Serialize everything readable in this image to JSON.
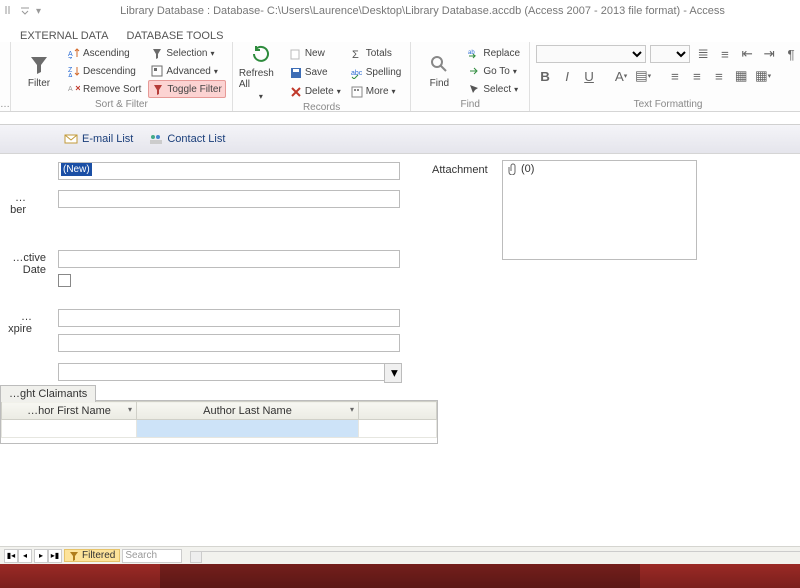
{
  "title": "Library Database : Database- C:\\Users\\Laurence\\Desktop\\Library Database.accdb (Access 2007 - 2013 file format) - Access",
  "tabs": {
    "external_data": "EXTERNAL DATA",
    "db_tools": "DATABASE TOOLS"
  },
  "ribbon": {
    "filter_btn": "Filter",
    "sort": {
      "asc": "Ascending",
      "desc": "Descending",
      "remove": "Remove Sort",
      "selection": "Selection",
      "advanced": "Advanced",
      "toggle": "Toggle Filter",
      "group": "Sort & Filter"
    },
    "refresh": "Refresh All",
    "records": {
      "new": "New",
      "save": "Save",
      "delete": "Delete",
      "totals": "Totals",
      "spelling": "Spelling",
      "more": "More",
      "group": "Records"
    },
    "find_big": "Find",
    "find": {
      "replace": "Replace",
      "goto": "Go To",
      "select": "Select",
      "group": "Find"
    },
    "format": {
      "bold": "B",
      "italic": "I",
      "underline": "U",
      "align": "A",
      "group": "Text Formatting"
    }
  },
  "subribbon": {
    "email": "E-mail List",
    "contacts": "Contact List"
  },
  "form": {
    "new_tag": "(New)",
    "labels": {
      "number": "…ber",
      "effective": "…ctive Date",
      "expire": "…xpire"
    },
    "attachment_label": "Attachment",
    "attachment_value": "(0)"
  },
  "subform": {
    "tab_label": "…ght Claimants",
    "col_first": "…hor First Name",
    "col_last": "Author Last Name"
  },
  "statusbar": {
    "filtered": "Filtered",
    "search": "Search"
  }
}
